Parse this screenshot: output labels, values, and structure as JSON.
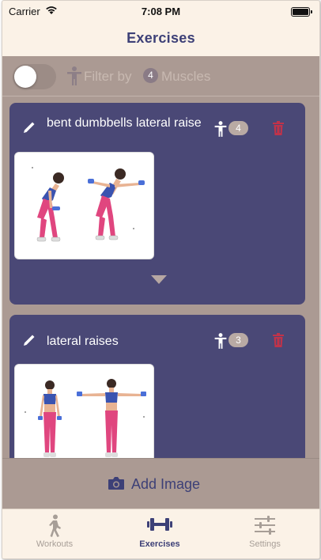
{
  "status_bar": {
    "carrier": "Carrier",
    "time": "7:08 PM"
  },
  "nav": {
    "title": "Exercises"
  },
  "filter": {
    "toggle_on": false,
    "label_before": "Filter by",
    "count": "4",
    "label_after": "Muscles"
  },
  "exercises": [
    {
      "title": "bent dumbbells lateral raise",
      "muscle_count": "4"
    },
    {
      "title": "lateral raises",
      "muscle_count": "3"
    }
  ],
  "add_image": {
    "label": "Add Image"
  },
  "tabs": [
    {
      "label": "Workouts",
      "icon": "walking-person-icon",
      "active": false
    },
    {
      "label": "Exercises",
      "icon": "dumbbell-icon",
      "active": true
    },
    {
      "label": "Settings",
      "icon": "sliders-icon",
      "active": false
    }
  ],
  "colors": {
    "accent": "#3d4077",
    "card": "#4a4876",
    "background": "#ab9a93",
    "delete": "#c0334a"
  }
}
